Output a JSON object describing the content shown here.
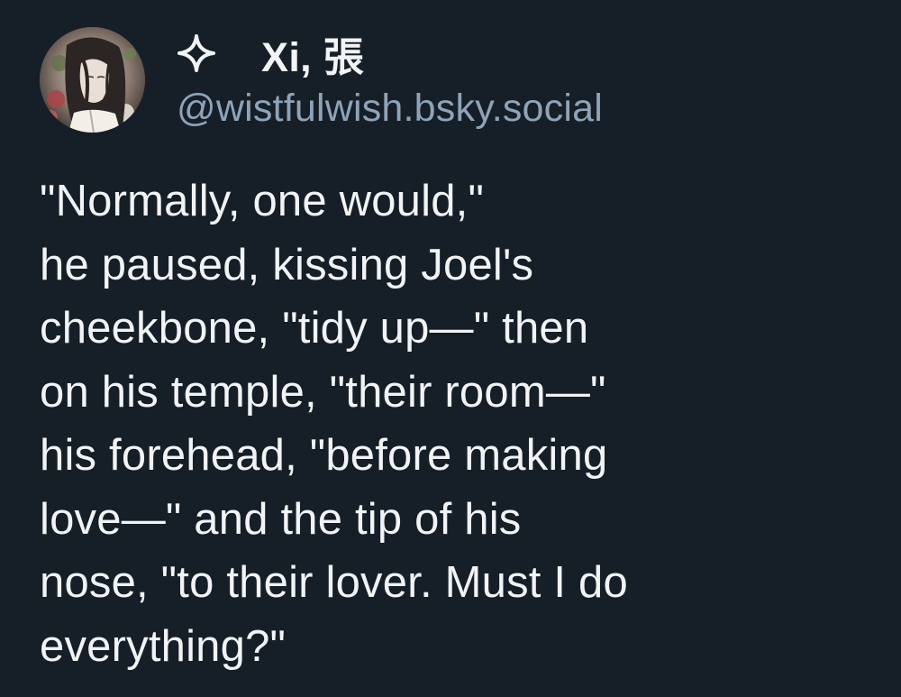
{
  "author": {
    "display_name": "Xi, 張",
    "handle": "@wistfulwish.bsky.social",
    "badge_icon": "sparkle-icon"
  },
  "post": {
    "lines": [
      "\"Normally, one would,\"",
      "he paused, kissing Joel's",
      "cheekbone, \"tidy up—\" then",
      "on his temple, \"their room—\"",
      "his forehead, \"before making",
      "love—\" and the tip of his",
      "nose, \"to their lover. Must I do",
      "everything?\""
    ]
  },
  "colors": {
    "background": "#161e27",
    "text": "#f1f3f5",
    "handle": "#8fa3b8"
  }
}
